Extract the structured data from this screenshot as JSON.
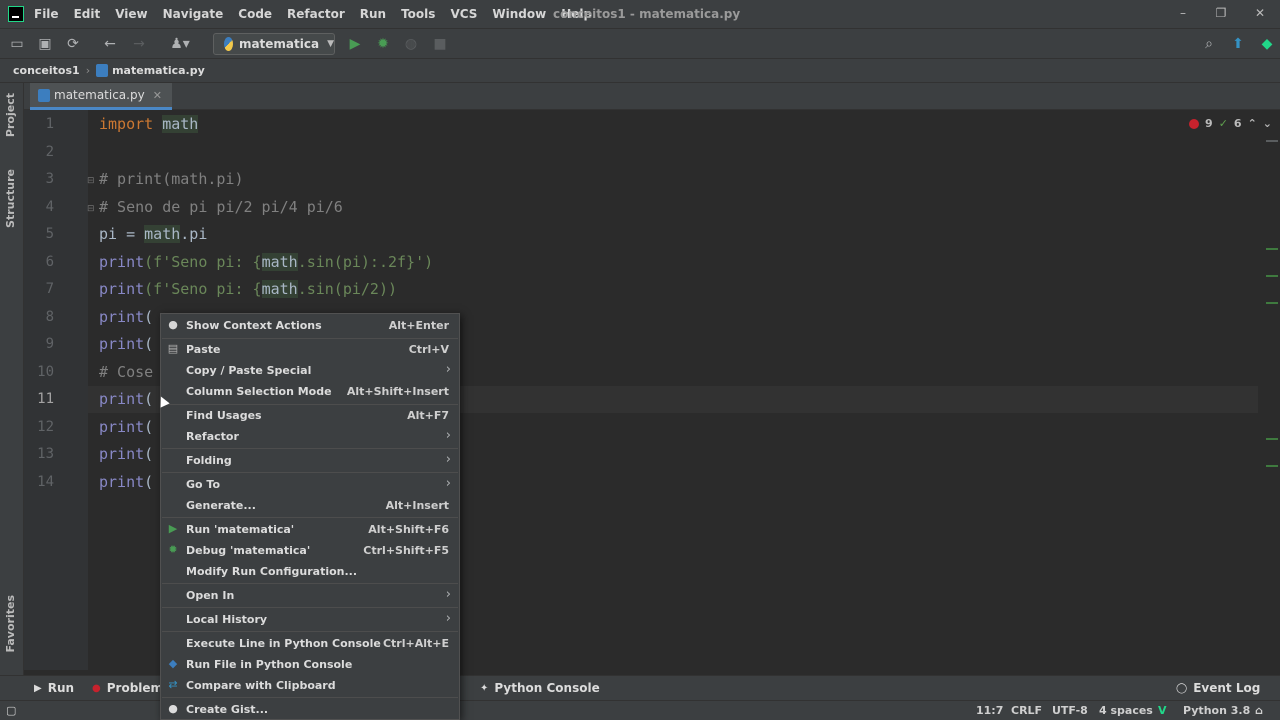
{
  "menu": [
    "File",
    "Edit",
    "View",
    "Navigate",
    "Code",
    "Refactor",
    "Run",
    "Tools",
    "VCS",
    "Window",
    "Help"
  ],
  "window_title": "conceitos1 - matematica.py",
  "run_config": "matematica",
  "breadcrumb": [
    "conceitos1",
    "matematica.py"
  ],
  "tab": {
    "name": "matematica.py"
  },
  "side_panels": {
    "project": "Project",
    "structure": "Structure",
    "favorites": "Favorites"
  },
  "inspections": {
    "errors": "9",
    "warnings": "6"
  },
  "code": {
    "line_numbers": [
      "1",
      "2",
      "3",
      "4",
      "5",
      "6",
      "7",
      "8",
      "9",
      "10",
      "11",
      "12",
      "13",
      "14"
    ],
    "l1_kw": "import",
    "l1_mod": "math",
    "l3": "# print(math.pi)",
    "l4": "# Seno de pi pi/2 pi/4 pi/6",
    "l5_a": "pi = ",
    "l5_mod": "math",
    "l5_b": ".pi",
    "l6_fn": "print",
    "l6_a": "(f'Seno pi: {",
    "l6_mod": "math",
    "l6_b": ".sin(pi):.2f}')",
    "l7_fn": "print",
    "l7_a": "(f'Seno pi: {",
    "l7_mod": "math",
    "l7_b": ".sin(pi/2))",
    "l8_fn": "print",
    "l8_a": "(",
    "l9_fn": "print",
    "l9_a": "(",
    "l10": "# Cose",
    "l11_fn": "print",
    "l11_a": "(",
    "l12_fn": "print",
    "l12_a": "(",
    "l13_fn": "print",
    "l13_a": "(",
    "l14_fn": "print",
    "l14_a": "("
  },
  "context_menu": {
    "show_context_actions": {
      "label": "Show Context Actions",
      "shortcut": "Alt+Enter"
    },
    "paste": {
      "label": "Paste",
      "shortcut": "Ctrl+V"
    },
    "copy_paste_special": {
      "label": "Copy / Paste Special"
    },
    "column_selection": {
      "label": "Column Selection Mode",
      "shortcut": "Alt+Shift+Insert"
    },
    "find_usages": {
      "label": "Find Usages",
      "shortcut": "Alt+F7"
    },
    "refactor": {
      "label": "Refactor"
    },
    "folding": {
      "label": "Folding"
    },
    "go_to": {
      "label": "Go To"
    },
    "generate": {
      "label": "Generate...",
      "shortcut": "Alt+Insert"
    },
    "run": {
      "label": "Run 'matematica'",
      "shortcut": "Alt+Shift+F6"
    },
    "debug": {
      "label": "Debug 'matematica'",
      "shortcut": "Ctrl+Shift+F5"
    },
    "modify_run": {
      "label": "Modify Run Configuration..."
    },
    "open_in": {
      "label": "Open In"
    },
    "local_history": {
      "label": "Local History"
    },
    "execute_line": {
      "label": "Execute Line in Python Console",
      "shortcut": "Ctrl+Alt+E"
    },
    "run_file_console": {
      "label": "Run File in Python Console"
    },
    "compare_clipboard": {
      "label": "Compare with Clipboard"
    },
    "create_gist": {
      "label": "Create Gist..."
    }
  },
  "bottom_tools": {
    "run": "Run",
    "problems": "Problems",
    "python_console": "Python Console",
    "event_log": "Event Log"
  },
  "status": {
    "position": "11:7",
    "line_sep": "CRLF",
    "encoding": "UTF-8",
    "indent": "4 spaces",
    "interpreter": "Python 3.8"
  },
  "colors": {
    "keyword": "#cc7832",
    "comment": "#808080",
    "builtin": "#8888c6",
    "string": "#6a8759",
    "error": "#c7222d",
    "run_green": "#499c54"
  }
}
